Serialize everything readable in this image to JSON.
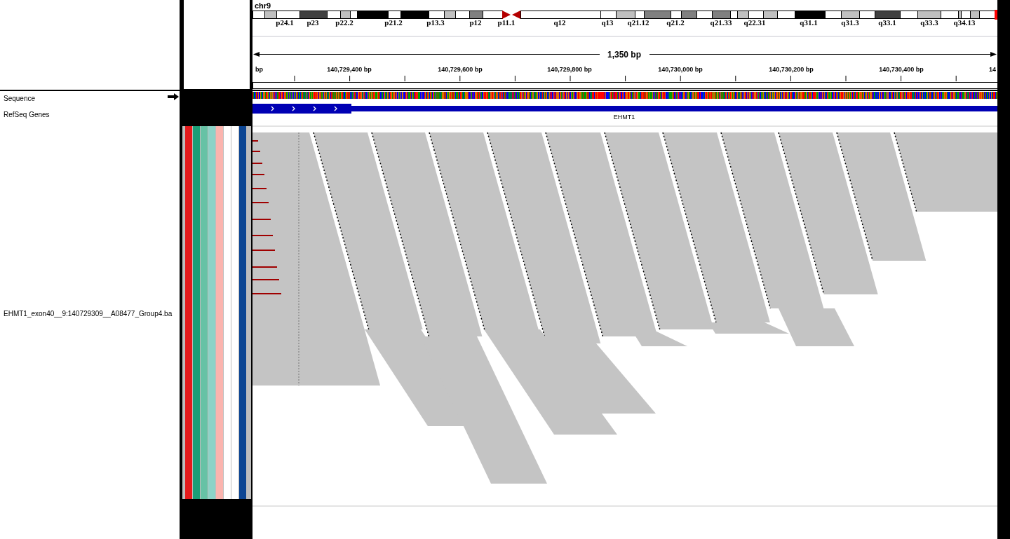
{
  "chromosome": {
    "name": "chr9",
    "bands": [
      {
        "kind": "band",
        "color": "#ffffff"
      },
      {
        "kind": "band",
        "color": "#c0c0c0"
      },
      {
        "kind": "band",
        "color": "#ffffff"
      },
      {
        "kind": "band",
        "color": "#404040"
      },
      {
        "kind": "band",
        "color": "#ffffff"
      },
      {
        "kind": "band",
        "color": "#c0c0c0"
      },
      {
        "kind": "band",
        "color": "#ffffff"
      },
      {
        "kind": "band",
        "color": "#000000"
      },
      {
        "kind": "band",
        "color": "#ffffff"
      },
      {
        "kind": "band",
        "color": "#000000"
      },
      {
        "kind": "band",
        "color": "#ffffff"
      },
      {
        "kind": "band",
        "color": "#c0c0c0"
      },
      {
        "kind": "band",
        "color": "#ffffff"
      },
      {
        "kind": "band",
        "color": "#808080"
      },
      {
        "kind": "band",
        "color": "#ffffff"
      },
      {
        "kind": "centromere",
        "color": "#b40000"
      },
      {
        "kind": "band",
        "color": "#ffffff"
      },
      {
        "kind": "band",
        "color": "#ffffff"
      },
      {
        "kind": "band",
        "color": "#c0c0c0"
      },
      {
        "kind": "band",
        "color": "#ffffff"
      },
      {
        "kind": "band",
        "color": "#808080"
      },
      {
        "kind": "band",
        "color": "#ffffff"
      },
      {
        "kind": "band",
        "color": "#808080"
      },
      {
        "kind": "band",
        "color": "#ffffff"
      },
      {
        "kind": "band",
        "color": "#808080"
      },
      {
        "kind": "band",
        "color": "#ffffff"
      },
      {
        "kind": "band",
        "color": "#c0c0c0"
      },
      {
        "kind": "band",
        "color": "#ffffff"
      },
      {
        "kind": "band",
        "color": "#c0c0c0"
      },
      {
        "kind": "band",
        "color": "#ffffff"
      },
      {
        "kind": "band",
        "color": "#000000"
      },
      {
        "kind": "band",
        "color": "#ffffff"
      },
      {
        "kind": "band",
        "color": "#c0c0c0"
      },
      {
        "kind": "band",
        "color": "#ffffff"
      },
      {
        "kind": "band",
        "color": "#404040"
      },
      {
        "kind": "band",
        "color": "#ffffff"
      },
      {
        "kind": "band",
        "color": "#c0c0c0"
      },
      {
        "kind": "band",
        "color": "#ffffff"
      },
      {
        "kind": "band",
        "color": "#c0c0c0"
      },
      {
        "kind": "band",
        "color": "#ffffff"
      },
      {
        "kind": "band",
        "color": "#c0c0c0"
      },
      {
        "kind": "band",
        "color": "#ffffff"
      }
    ],
    "band_labels": [
      "p24.1",
      "p23",
      "p22.2",
      "p21.2",
      "p13.3",
      "p12",
      "p11.1",
      "q12",
      "q13",
      "q21.12",
      "q21.2",
      "q21.33",
      "q22.31",
      "q31.1",
      "q31.3",
      "q33.1",
      "q33.3",
      "q34.13"
    ]
  },
  "ruler": {
    "span": "1,350 bp",
    "tick_labels": [
      "bp",
      "140,729,400 bp",
      "140,729,600 bp",
      "140,729,800 bp",
      "140,730,000 bp",
      "140,730,200 bp",
      "140,730,400 bp",
      "14"
    ]
  },
  "track_names": [
    {
      "name": "Sequence",
      "kind": "sequence"
    },
    {
      "name": "RefSeq Genes",
      "kind": "genes"
    },
    {
      "name": "EHMT1_exon40__9:140729309__A08477_Group4.ba",
      "kind": "alignment"
    }
  ],
  "gene": {
    "name": "EHMT1"
  },
  "attribute_colors": [
    {
      "color": "#e41a1c"
    },
    {
      "color": "#1b9e77"
    },
    {
      "color": "#66c2a5"
    },
    {
      "color": "#8dd3c7"
    },
    {
      "color": "#fbb4ae"
    },
    {
      "color": "#ffffff"
    },
    {
      "color": "#ffffff"
    },
    {
      "color": "#0c4593"
    }
  ]
}
